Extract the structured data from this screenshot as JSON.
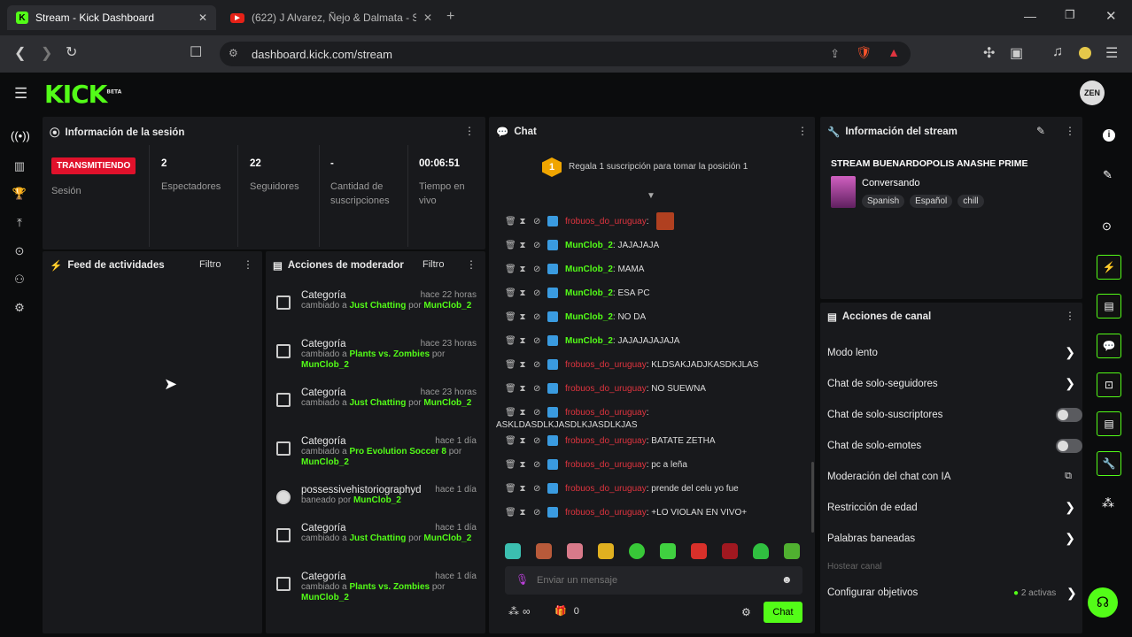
{
  "browser": {
    "tabs": [
      {
        "title": "Stream - Kick Dashboard",
        "active": true
      },
      {
        "title": "(622) J Alvarez, Ñejo & Dalmata - Se",
        "active": false
      }
    ],
    "url": "dashboard.kick.com/stream"
  },
  "app": {
    "logo": "KICK",
    "logo_sup": "BETA"
  },
  "session": {
    "title": "Información de la sesión",
    "live_badge": "TRANSMITIENDO",
    "session_label": "Sesión",
    "stats": [
      {
        "value": "2",
        "label": "Espectadores"
      },
      {
        "value": "22",
        "label": "Seguidores"
      },
      {
        "value": "-",
        "label": "Cantidad de suscripciones"
      },
      {
        "value": "00:06:51",
        "label": "Tiempo en vivo"
      }
    ]
  },
  "feed": {
    "title": "Feed de actividades",
    "filter": "Filtro"
  },
  "mod": {
    "title": "Acciones de moderador",
    "filter": "Filtro",
    "items": [
      {
        "title": "Categoría",
        "time": "hace 22 horas",
        "pre": "cambiado a ",
        "cat": "Just Chatting",
        "mid": " por ",
        "user": "MunClob_2"
      },
      {
        "title": "Categoría",
        "time": "hace 23 horas",
        "pre": "cambiado a ",
        "cat": "Plants vs. Zombies",
        "mid": " por ",
        "user": "MunClob_2"
      },
      {
        "title": "Categoría",
        "time": "hace 23 horas",
        "pre": "cambiado a ",
        "cat": "Just Chatting",
        "mid": " por ",
        "user": "MunClob_2"
      },
      {
        "title": "Categoría",
        "time": "hace 1 día",
        "pre": "cambiado a ",
        "cat": "Pro Evolution Soccer 8",
        "mid": " por ",
        "user": "MunClob_2"
      },
      {
        "title": "possessivehistoriographyd",
        "time": "hace 1 día",
        "pre": "baneado por ",
        "cat": "",
        "mid": "",
        "user": "MunClob_2"
      },
      {
        "title": "Categoría",
        "time": "hace 1 día",
        "pre": "cambiado a ",
        "cat": "Just Chatting",
        "mid": " por ",
        "user": "MunClob_2"
      },
      {
        "title": "Categoría",
        "time": "hace 1 día",
        "pre": "cambiado a ",
        "cat": "Plants vs. Zombies",
        "mid": " por ",
        "user": "MunClob_2"
      }
    ]
  },
  "chat": {
    "title": "Chat",
    "gift_badge": "1",
    "gift_text": "Regala 1 suscripción para tomar la posición 1",
    "messages": [
      {
        "user": "frobuos_do_uruguay",
        "color": "red",
        "text": ":"
      },
      {
        "user": "MunClob_2",
        "color": "green",
        "text": ": JAJAJAJA"
      },
      {
        "user": "MunClob_2",
        "color": "green",
        "text": ": MAMA"
      },
      {
        "user": "MunClob_2",
        "color": "green",
        "text": ": ESA PC"
      },
      {
        "user": "MunClob_2",
        "color": "green",
        "text": ": NO DA"
      },
      {
        "user": "MunClob_2",
        "color": "green",
        "text": ": JAJAJAJAJAJA"
      },
      {
        "user": "frobuos_do_uruguay",
        "color": "red",
        "text": ": KLDSAKJADJKASDKJLAS"
      },
      {
        "user": "frobuos_do_uruguay",
        "color": "red",
        "text": ": NO SUEWNA"
      },
      {
        "user": "frobuos_do_uruguay",
        "color": "red",
        "text": ":",
        "wrap": "ASKLDASDLKJASDLKJASDLKJAS"
      },
      {
        "user": "frobuos_do_uruguay",
        "color": "red",
        "text": ": BATATE ZETHA"
      },
      {
        "user": "frobuos_do_uruguay",
        "color": "red",
        "text": ": pc a leña"
      },
      {
        "user": "frobuos_do_uruguay",
        "color": "red",
        "text": ": prende del celu yo fue"
      },
      {
        "user": "frobuos_do_uruguay",
        "color": "red",
        "text": ": +LO VIOLAN EN VIVO+"
      }
    ],
    "input_placeholder": "Enviar un mensaje",
    "viewers": "∞",
    "gifts": "0",
    "send_label": "Chat"
  },
  "stream": {
    "title": "Información del stream",
    "name": "STREAM BUENARDOPOLIS ANASHE PRIME",
    "category": "Conversando",
    "tags": [
      "Spanish",
      "Español",
      "chill"
    ]
  },
  "channel": {
    "title": "Acciones de canal",
    "items": [
      {
        "label": "Modo lento",
        "kind": "chevron"
      },
      {
        "label": "Chat de solo-seguidores",
        "kind": "chevron"
      },
      {
        "label": "Chat de solo-suscriptores",
        "kind": "toggle"
      },
      {
        "label": "Chat de solo-emotes",
        "kind": "toggle"
      },
      {
        "label": "Moderación del chat con IA",
        "kind": "external"
      },
      {
        "label": "Restricción de edad",
        "kind": "chevron"
      },
      {
        "label": "Palabras baneadas",
        "kind": "chevron"
      }
    ],
    "host_label": "Hostear canal",
    "goals_label": "Configurar objetivos",
    "goals_status": "2 activas"
  },
  "colors": {
    "accent": "#53fc18",
    "live": "#e0112b"
  }
}
